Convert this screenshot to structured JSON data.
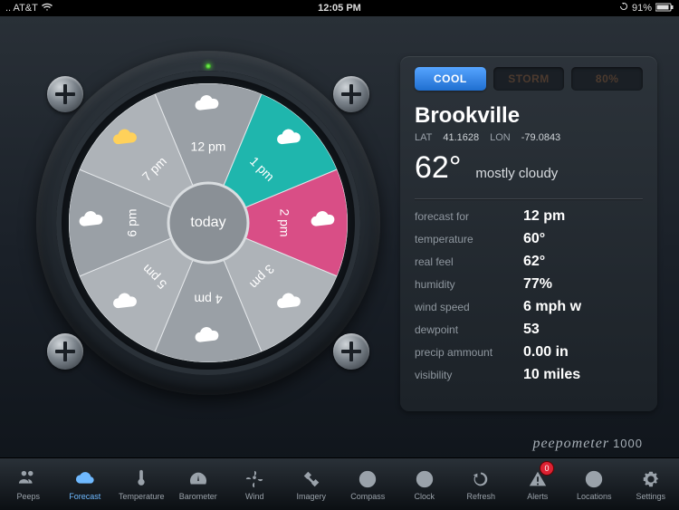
{
  "status": {
    "carrier": ".. AT&T",
    "wifi_icon": "wifi",
    "time": "12:05 PM",
    "lock_icon": "lock",
    "battery_pct": "91%",
    "battery_icon": "battery"
  },
  "gauge": {
    "center_label": "today",
    "slices": [
      {
        "label": "12 pm",
        "icon": "cloud",
        "fill": "#9aa0a6"
      },
      {
        "label": "1 pm",
        "icon": "cloud",
        "fill": "#1fb6ad"
      },
      {
        "label": "2 pm",
        "icon": "cloud",
        "fill": "#d94e86"
      },
      {
        "label": "3 pm",
        "icon": "cloud",
        "fill": "#aeb3b8"
      },
      {
        "label": "4 pm",
        "icon": "cloud",
        "fill": "#9aa0a6"
      },
      {
        "label": "5 pm",
        "icon": "cloud",
        "fill": "#aeb3b8"
      },
      {
        "label": "6 pm",
        "icon": "cloud",
        "fill": "#9aa0a6"
      },
      {
        "label": "7 pm",
        "icon": "partly",
        "fill": "#aeb3b8"
      }
    ]
  },
  "badges": {
    "cool": "COOL",
    "storm": "STORM",
    "pct": "80%"
  },
  "location": {
    "name": "Brookville",
    "lat_label": "LAT",
    "lat": "41.1628",
    "lon_label": "LON",
    "lon": "-79.0843",
    "current_temp": "62°",
    "current_cond": "mostly cloudy"
  },
  "details": [
    {
      "k": "forecast for",
      "v": "12 pm"
    },
    {
      "k": "temperature",
      "v": "60°"
    },
    {
      "k": "real feel",
      "v": "62°"
    },
    {
      "k": "humidity",
      "v": "77%"
    },
    {
      "k": "wind speed",
      "v": "6 mph w"
    },
    {
      "k": "dewpoint",
      "v": "53"
    },
    {
      "k": "precip ammount",
      "v": "0.00 in"
    },
    {
      "k": "visibility",
      "v": "10 miles"
    }
  ],
  "brand": {
    "name": "peepometer",
    "model": "1000"
  },
  "tabs": [
    {
      "label": "Peeps",
      "icon": "people",
      "active": false
    },
    {
      "label": "Forecast",
      "icon": "cloud",
      "active": true
    },
    {
      "label": "Temperature",
      "icon": "thermo",
      "active": false
    },
    {
      "label": "Barometer",
      "icon": "gauge",
      "active": false
    },
    {
      "label": "Wind",
      "icon": "fan",
      "active": false
    },
    {
      "label": "Imagery",
      "icon": "sat",
      "active": false
    },
    {
      "label": "Compass",
      "icon": "compass",
      "active": false
    },
    {
      "label": "Clock",
      "icon": "clock",
      "active": false
    },
    {
      "label": "Refresh",
      "icon": "refresh",
      "active": false
    },
    {
      "label": "Alerts",
      "icon": "alert",
      "active": false,
      "badge": "0"
    },
    {
      "label": "Locations",
      "icon": "pin",
      "active": false
    },
    {
      "label": "Settings",
      "icon": "gear",
      "active": false
    }
  ]
}
